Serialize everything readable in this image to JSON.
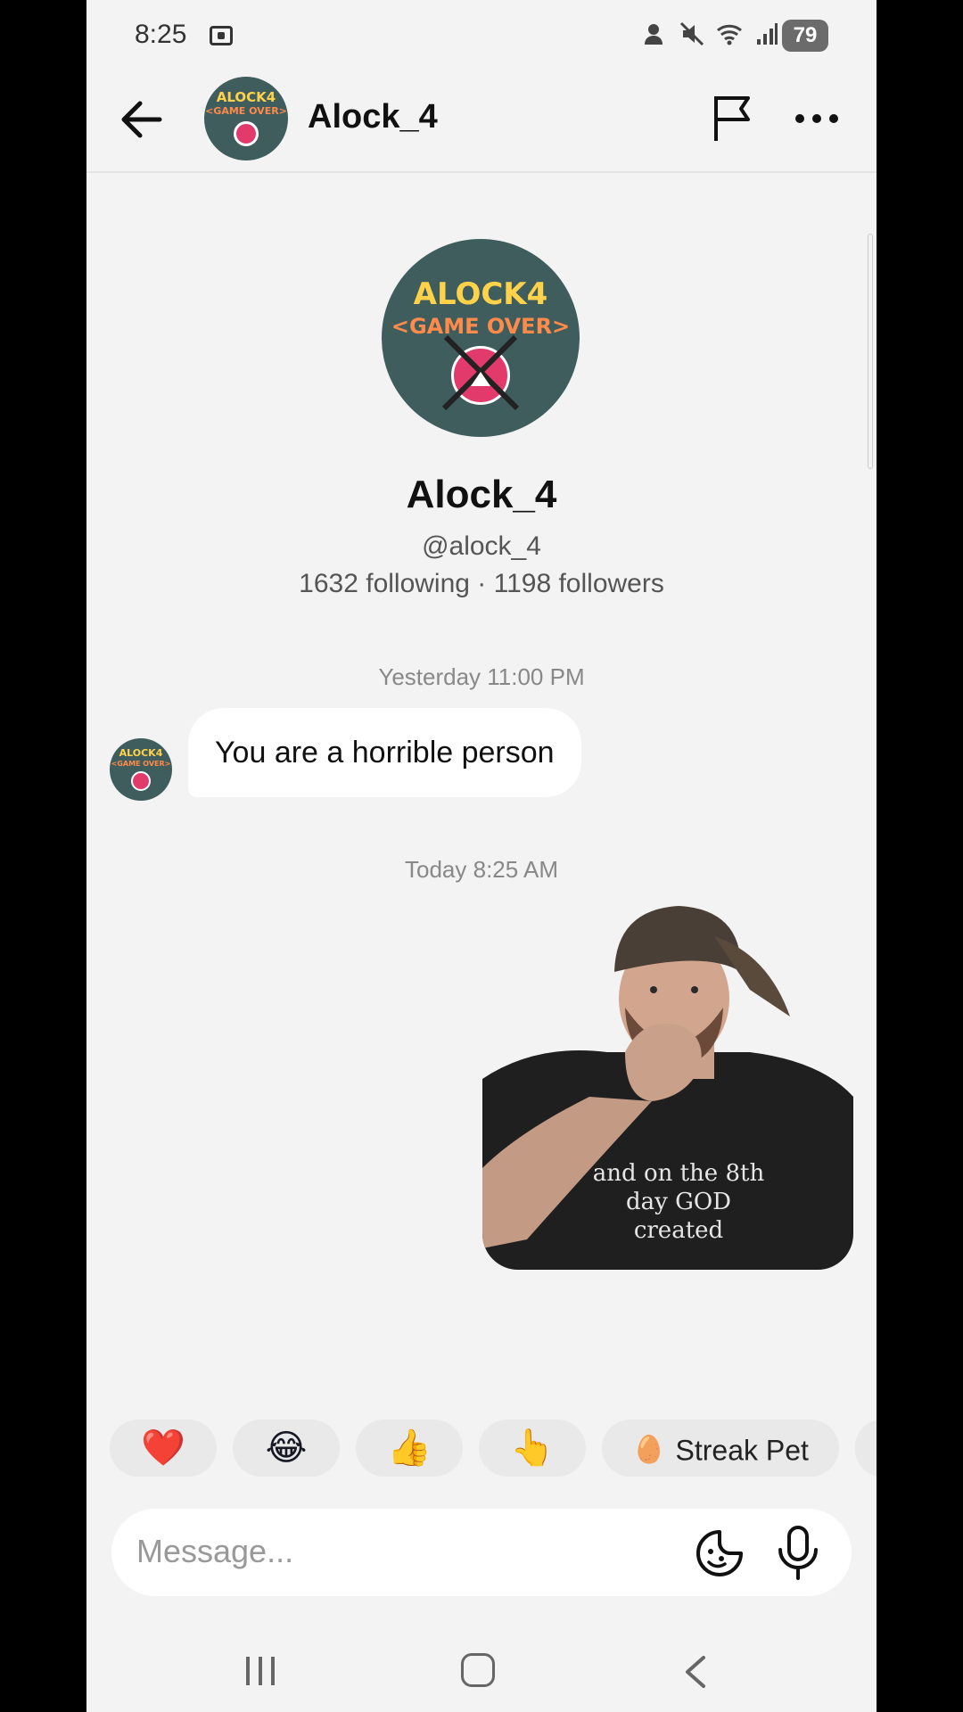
{
  "status_bar": {
    "time": "8:25",
    "system_icons": [
      "person-icon",
      "mute-icon",
      "wifi-icon",
      "signal-icon"
    ],
    "battery": "79"
  },
  "header": {
    "title": "Alock_4",
    "avatar_text_line1": "ALOCK4",
    "avatar_text_line2": "<GAME OVER>"
  },
  "profile": {
    "name": "Alock_4",
    "handle": "@alock_4",
    "stats": "1632 following · 1198 followers",
    "avatar_text_line1": "ALOCK4",
    "avatar_text_line2": "<GAME OVER>"
  },
  "messages": [
    {
      "timestamp": "Yesterday 11:00 PM",
      "sender": "other",
      "text": "You are a horrible person"
    },
    {
      "timestamp": "Today 8:25 AM",
      "sender": "self",
      "sticker_caption": "and on the 8th day GOD created"
    }
  ],
  "quick_reactions": [
    {
      "icon": "heart-icon",
      "glyph": "❤️"
    },
    {
      "icon": "laughing-emoji-icon",
      "glyph": "😂"
    },
    {
      "icon": "thumbs-up-icon",
      "glyph": "👍"
    },
    {
      "icon": "pointing-hand-icon",
      "glyph": "👆"
    },
    {
      "icon": "egg-icon",
      "glyph": "🥚",
      "label": "Streak Pet"
    }
  ],
  "composer": {
    "placeholder": "Message..."
  },
  "colors": {
    "background": "#f3f3f3",
    "bubble": "#ffffff",
    "chip": "#e9e9e9",
    "avatar_bg": "#3f5d5d",
    "avatar_accent": "#e33a6c"
  }
}
